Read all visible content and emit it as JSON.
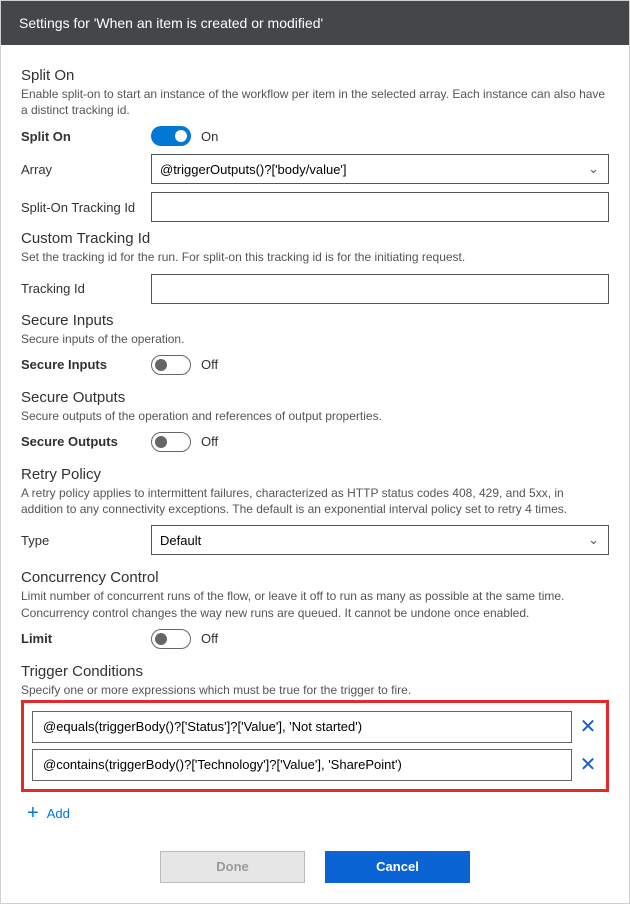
{
  "header": {
    "title": "Settings for 'When an item is created or modified'"
  },
  "splitOn": {
    "title": "Split On",
    "desc": "Enable split-on to start an instance of the workflow per item in the selected array. Each instance can also have a distinct tracking id.",
    "label": "Split On",
    "state": "On",
    "arrayLabel": "Array",
    "arrayValue": "@triggerOutputs()?['body/value']",
    "trackingLabel": "Split-On Tracking Id",
    "trackingValue": ""
  },
  "customTracking": {
    "title": "Custom Tracking Id",
    "desc": "Set the tracking id for the run. For split-on this tracking id is for the initiating request.",
    "label": "Tracking Id",
    "value": ""
  },
  "secureInputs": {
    "title": "Secure Inputs",
    "desc": "Secure inputs of the operation.",
    "label": "Secure Inputs",
    "state": "Off"
  },
  "secureOutputs": {
    "title": "Secure Outputs",
    "desc": "Secure outputs of the operation and references of output properties.",
    "label": "Secure Outputs",
    "state": "Off"
  },
  "retryPolicy": {
    "title": "Retry Policy",
    "desc": "A retry policy applies to intermittent failures, characterized as HTTP status codes 408, 429, and 5xx, in addition to any connectivity exceptions. The default is an exponential interval policy set to retry 4 times.",
    "label": "Type",
    "value": "Default"
  },
  "concurrency": {
    "title": "Concurrency Control",
    "desc": "Limit number of concurrent runs of the flow, or leave it off to run as many as possible at the same time. Concurrency control changes the way new runs are queued. It cannot be undone once enabled.",
    "label": "Limit",
    "state": "Off"
  },
  "triggerConditions": {
    "title": "Trigger Conditions",
    "desc": "Specify one or more expressions which must be true for the trigger to fire.",
    "items": [
      "@equals(triggerBody()?['Status']?['Value'], 'Not started')",
      "@contains(triggerBody()?['Technology']?['Value'], 'SharePoint')"
    ],
    "addLabel": "Add"
  },
  "footer": {
    "done": "Done",
    "cancel": "Cancel"
  }
}
